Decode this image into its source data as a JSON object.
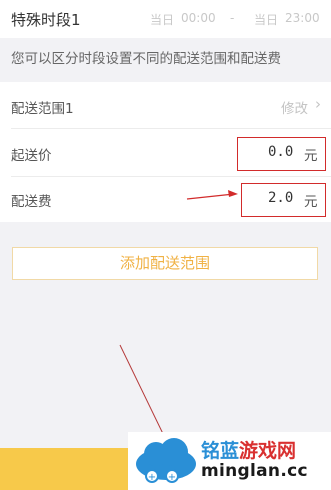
{
  "time_section": {
    "title": "特殊时段1",
    "start_day": "当日",
    "start_time": "00:00",
    "dash": "-",
    "end_day": "当日",
    "end_time": "23:00"
  },
  "notice": "您可以区分时段设置不同的配送范围和配送费",
  "range_row": {
    "label": "配送范围1",
    "action": "修改",
    "chevron": "›"
  },
  "min_price_row": {
    "label": "起送价",
    "value": "0.0",
    "unit": "元"
  },
  "fee_row": {
    "label": "配送费",
    "value": "2.0",
    "unit": "元"
  },
  "add_button": "添加配送范围",
  "watermark": {
    "cn_part1": "铭蓝",
    "cn_part2": "游戏网",
    "en": "minglan.cc"
  },
  "colors": {
    "accent": "#f0b245",
    "annotation_red": "#d22b2b",
    "bottom_bar": "#f7c94a",
    "watermark_blue": "#2a8fd6",
    "watermark_red": "#d93030"
  }
}
